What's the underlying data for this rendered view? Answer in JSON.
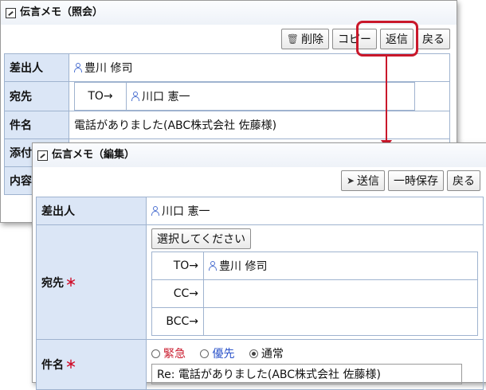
{
  "window1": {
    "title": "伝言メモ（照会）",
    "buttons": {
      "delete": "削除",
      "copy": "コピー",
      "reply": "返信",
      "back": "戻る"
    },
    "rows": {
      "sender_label": "差出人",
      "sender": "豊川 修司",
      "to_label": "宛先",
      "to_prefix": "TO→",
      "to_user": "川口 憲一",
      "subject_label": "件名",
      "subject": "電話がありました(ABC株式会社 佐藤様)",
      "attach_label": "添付",
      "content_label": "内容"
    }
  },
  "window2": {
    "title": "伝言メモ（編集）",
    "buttons": {
      "send": "送信",
      "save_draft": "一時保存",
      "back": "戻る"
    },
    "rows": {
      "sender_label": "差出人",
      "sender": "川口 憲一",
      "to_label": "宛先",
      "required_mark": "＊",
      "select_button": "選択してください",
      "to_prefix": "TO→",
      "to_user": "豊川 修司",
      "cc_prefix": "CC→",
      "bcc_prefix": "BCC→",
      "subject_label": "件名",
      "priority": {
        "urgent": "緊急",
        "priority": "優先",
        "normal": "通常",
        "selected": "normal"
      },
      "subject_value": "Re: 電話がありました(ABC株式会社 佐藤様)"
    }
  },
  "colors": {
    "header_bg": "#dbe6f6",
    "highlight": "#c9182b",
    "user_icon": "#4a6fd0",
    "urgent": "#c9182b",
    "priority": "#2a52c9"
  }
}
